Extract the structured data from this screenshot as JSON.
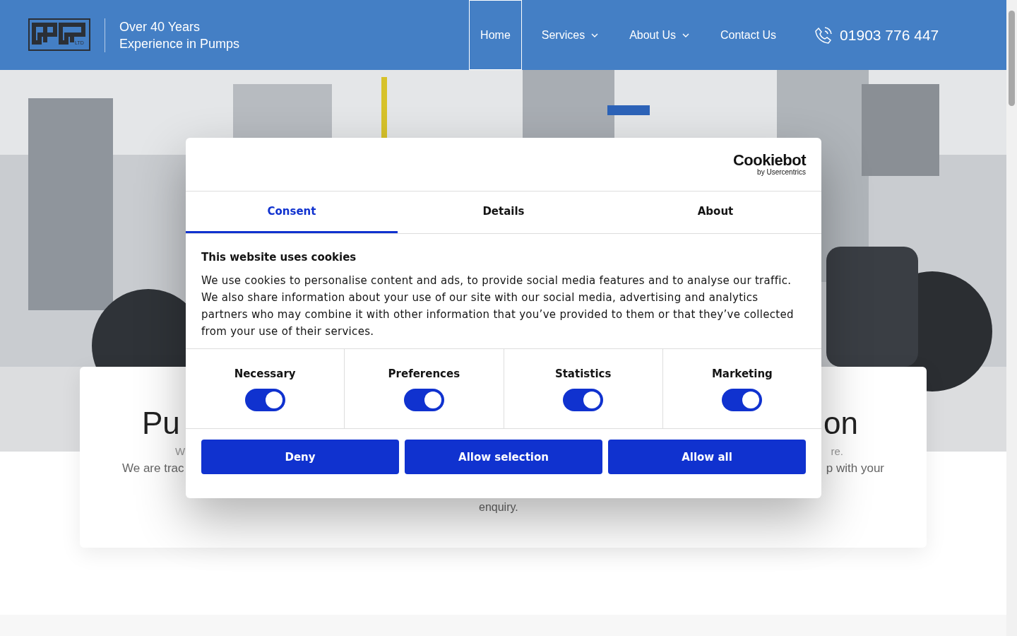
{
  "header": {
    "tagline": [
      "Over 40 Years",
      "Experience in Pumps"
    ],
    "logo_badge": "LTD",
    "nav": [
      {
        "label": "Home",
        "selected": true,
        "dropdown": false
      },
      {
        "label": "Services",
        "selected": false,
        "dropdown": true
      },
      {
        "label": "About Us",
        "selected": false,
        "dropdown": true
      },
      {
        "label": "Contact Us",
        "selected": false,
        "dropdown": false
      }
    ],
    "phone": "01903 776 447"
  },
  "card": {
    "heading": [
      "Pu",
      "on"
    ],
    "lines": [
      [
        "W",
        "re."
      ],
      [
        "We are trac",
        "p with your"
      ]
    ],
    "last_line": "enquiry."
  },
  "cookie_dialog": {
    "brand": "Cookiebot",
    "brand_sub": "by Usercentrics",
    "tabs": [
      {
        "label": "Consent",
        "selected": true
      },
      {
        "label": "Details",
        "selected": false
      },
      {
        "label": "About",
        "selected": false
      }
    ],
    "title": "This website uses cookies",
    "body": "We use cookies to personalise content and ads, to provide social media features and to analyse our traffic. We also share information about your use of our site with our social media, advertising and analytics partners who may combine it with other information that you’ve provided to them or that they’ve collected from your use of their services.",
    "categories": [
      {
        "label": "Necessary",
        "on": true
      },
      {
        "label": "Preferences",
        "on": true
      },
      {
        "label": "Statistics",
        "on": true
      },
      {
        "label": "Marketing",
        "on": true
      }
    ],
    "buttons": [
      "Deny",
      "Allow selection",
      "Allow all"
    ]
  }
}
